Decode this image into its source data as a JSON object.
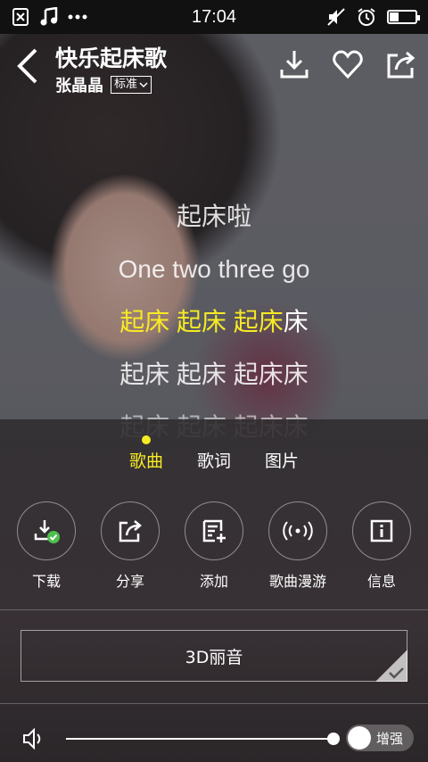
{
  "statusbar": {
    "time": "17:04",
    "battery_level": 0.35
  },
  "header": {
    "title": "快乐起床歌",
    "artist": "张晶晶",
    "quality": "标准"
  },
  "lyrics": [
    {
      "text": "起床啦",
      "state": "past"
    },
    {
      "text": "One two three go",
      "state": "past"
    },
    {
      "sung": "起床 起床 起床",
      "rest": "床",
      "state": "current"
    },
    {
      "text": "起床 起床 起床床",
      "state": "next"
    },
    {
      "text": "起床 起床 起床床",
      "state": "fade"
    }
  ],
  "tabs": [
    {
      "label": "歌曲",
      "active": true
    },
    {
      "label": "歌词",
      "active": false
    },
    {
      "label": "图片",
      "active": false
    }
  ],
  "actions": [
    {
      "label": "下载",
      "icon": "download-check-icon"
    },
    {
      "label": "分享",
      "icon": "share-icon"
    },
    {
      "label": "添加",
      "icon": "add-playlist-icon"
    },
    {
      "label": "歌曲漫游",
      "icon": "roaming-icon"
    },
    {
      "label": "信息",
      "icon": "info-icon"
    }
  ],
  "sound_effect": {
    "label": "3D丽音"
  },
  "volume": {
    "level": 1.0,
    "boost_label": "增强",
    "boost_on": false
  },
  "colors": {
    "accent": "#f7ea25",
    "check": "#4cc04f"
  }
}
